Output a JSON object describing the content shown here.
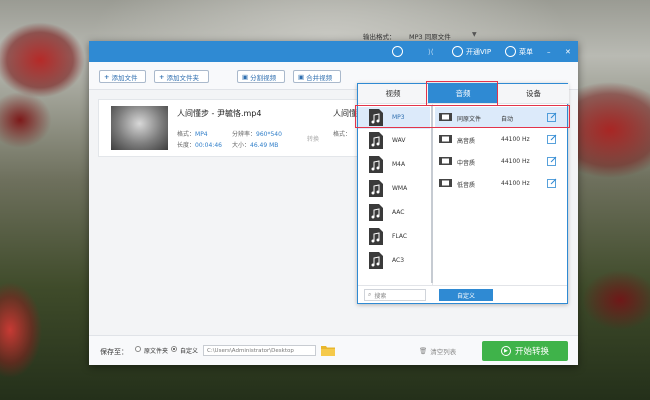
{
  "window": {
    "vip_label": "开通VIP",
    "menu_label": "菜单",
    "minimize": "–",
    "close": "✕"
  },
  "toolbar": {
    "add_file": "添加文件",
    "add_folder": "添加文件夹",
    "split_video": "分割视频",
    "merge_video": "合并视频",
    "output_format_label": "输出格式：",
    "output_format_value": "MP3  同原文件",
    "dropdown_arrow": "▼"
  },
  "file": {
    "name": "人间懂步 - 尹毓恪.mp4",
    "format_label": "格式：",
    "format": "MP4",
    "resolution_label": "分辨率：",
    "resolution": "960*540",
    "duration_label": "长度：",
    "duration": "00:04:46",
    "size_label": "大小：",
    "size": "46.49 MB",
    "arrow_text": "转换",
    "output_name": "人间懂步"
  },
  "footer": {
    "save_to": "保存至：",
    "radio_original": "原文件夹",
    "radio_custom": "自定义",
    "path": "C:\\Users\\Administrator\\Desktop",
    "clear_list": "清空列表",
    "start": "开始转换"
  },
  "popup": {
    "tabs": [
      "视频",
      "音频",
      "设备"
    ],
    "formats": [
      "MP3",
      "WAV",
      "M4A",
      "WMA",
      "AAC",
      "FLAC",
      "AC3"
    ],
    "qualities": [
      {
        "name": "同原文件",
        "rate": "自动"
      },
      {
        "name": "高音质",
        "rate": "44100 Hz"
      },
      {
        "name": "中音质",
        "rate": "44100 Hz"
      },
      {
        "name": "低音质",
        "rate": "44100 Hz"
      }
    ],
    "search_placeholder": "搜索",
    "custom_button": "自定义"
  },
  "colors": {
    "accent": "#2f8ad3",
    "start": "#3fb34a",
    "highlight": "#e2344a"
  }
}
